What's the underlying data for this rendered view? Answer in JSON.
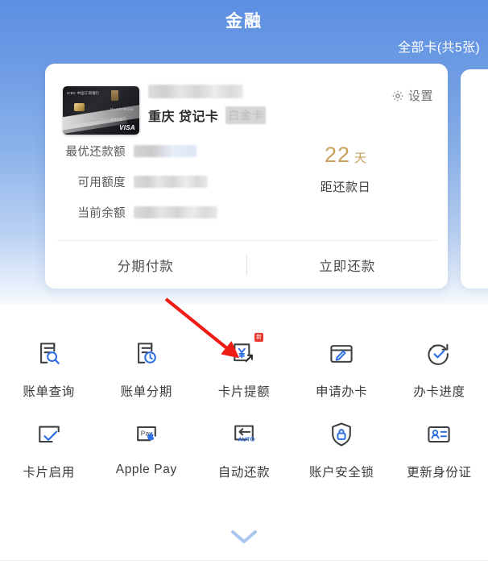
{
  "header": {
    "title": "金融",
    "all_cards_link": "全部卡(共5张)"
  },
  "card": {
    "thumbnail": {
      "bank_mark": "ICBC 中国工商银行",
      "platinum_text": "PLATINUM",
      "network": "VISA",
      "masked_number": "4372 **** **** 8888"
    },
    "number_masked": "",
    "name": "重庆 贷记卡",
    "level_badge": "白金卡",
    "settings_label": "设置",
    "settings_icon": "gear-icon",
    "stats": [
      {
        "label": "最优还款额",
        "value": ""
      },
      {
        "label": "可用额度",
        "value": ""
      },
      {
        "label": "当前余额",
        "value": ""
      }
    ],
    "due": {
      "days": "22",
      "unit": "天",
      "label": "距还款日"
    },
    "actions": [
      {
        "label": "分期付款"
      },
      {
        "label": "立即还款"
      }
    ]
  },
  "grid": {
    "items": [
      {
        "label": "账单查询",
        "icon": "bill-search-icon",
        "badge": ""
      },
      {
        "label": "账单分期",
        "icon": "bill-installment-icon",
        "badge": ""
      },
      {
        "label": "卡片提额",
        "icon": "credit-increase-icon",
        "badge": "新"
      },
      {
        "label": "申请办卡",
        "icon": "apply-card-icon",
        "badge": ""
      },
      {
        "label": "办卡进度",
        "icon": "application-progress-icon",
        "badge": ""
      },
      {
        "label": "卡片启用",
        "icon": "card-activate-icon",
        "badge": ""
      },
      {
        "label": "Apple Pay",
        "icon": "apple-pay-icon",
        "badge": ""
      },
      {
        "label": "自动还款",
        "icon": "auto-repay-icon",
        "badge": ""
      },
      {
        "label": "账户安全锁",
        "icon": "security-lock-icon",
        "badge": ""
      },
      {
        "label": "更新身份证",
        "icon": "update-id-icon",
        "badge": ""
      }
    ]
  },
  "footer": {
    "expand_icon": "chevron-down-icon"
  },
  "colors": {
    "hero_top": "#5b8fe0",
    "hero_bottom": "#e4edfa",
    "accent_blue": "#2f6fe4",
    "icon_dark": "#3c4043",
    "gold": "#c9a05c",
    "badge_red": "#e8342a",
    "chevron": "#a9c6ef"
  }
}
